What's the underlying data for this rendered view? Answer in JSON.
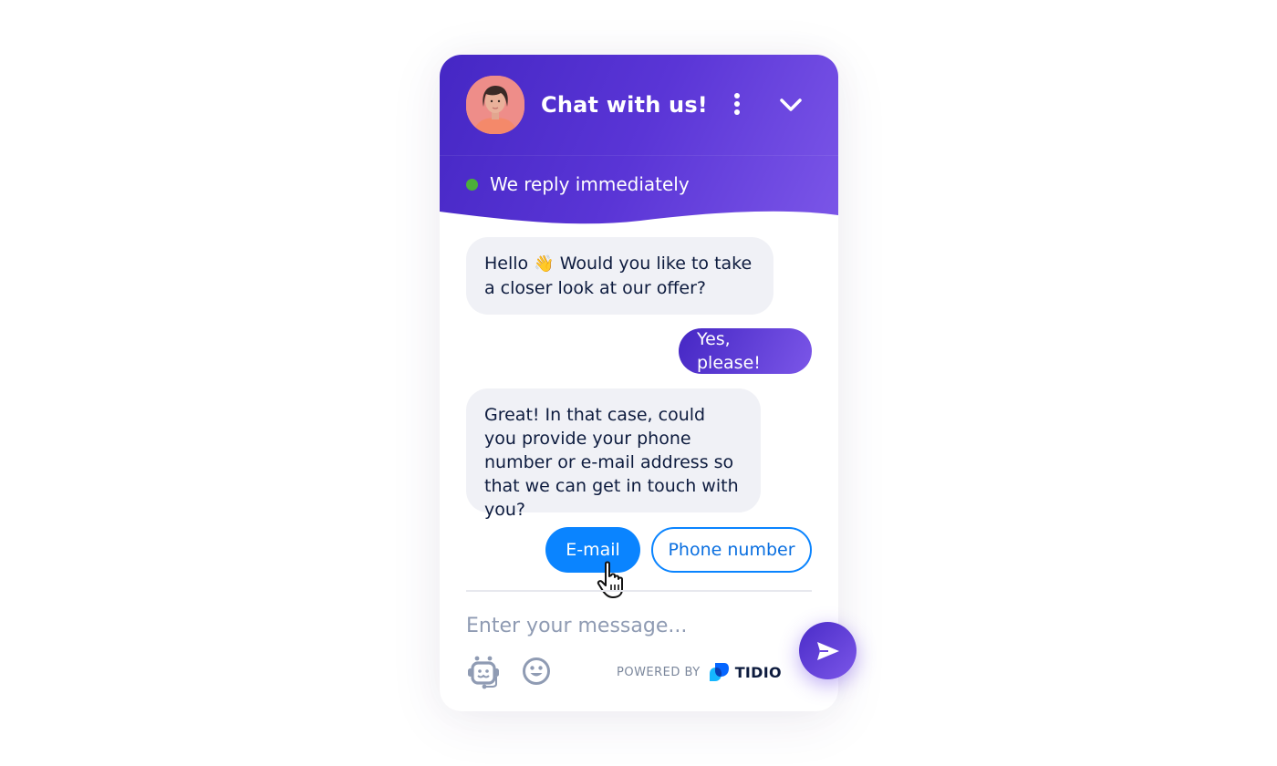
{
  "header": {
    "title": "Chat with us!",
    "status_text": "We reply immediately",
    "status_color": "#4caf3a",
    "avatar_alt": "agent-avatar",
    "menu_icon": "more-vertical-icon",
    "collapse_icon": "chevron-down-icon"
  },
  "messages": [
    {
      "sender": "bot",
      "text_before_emoji": "Hello",
      "emoji": "👋",
      "text_after_emoji": "Would you like to take a closer look at our offer?"
    },
    {
      "sender": "user",
      "text": "Yes, please!"
    },
    {
      "sender": "bot",
      "text": "Great! In that case, could you provide your phone number or e-mail address so that we can get in touch with you?"
    }
  ],
  "quick_replies": [
    {
      "label": "E-mail",
      "state": "hover"
    },
    {
      "label": "Phone number",
      "state": "default"
    }
  ],
  "composer": {
    "placeholder": "Enter your message...",
    "value": "",
    "bot_icon": "chatbot-icon",
    "emoji_icon": "smiley-icon",
    "send_icon": "send-icon"
  },
  "branding": {
    "powered_by": "POWERED BY",
    "brand": "TIDIO"
  },
  "colors": {
    "accent": "#5a35d6",
    "quick_reply": "#0a84ff"
  }
}
